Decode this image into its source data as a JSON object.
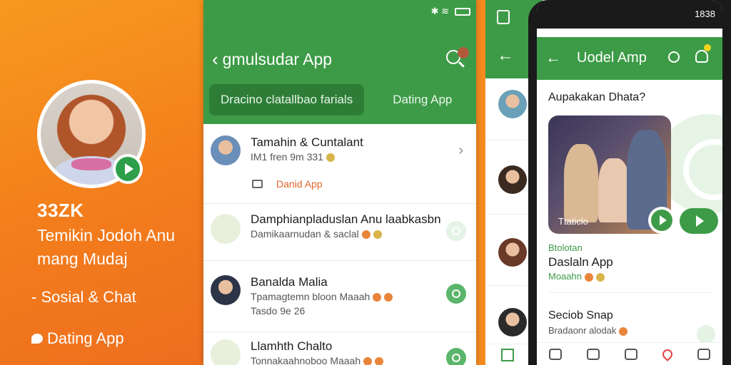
{
  "promo": {
    "brand": "33ZK",
    "tagline": "Temikin Jodoh Anu mang Mudaj",
    "feature_1": "- Sosial & Chat",
    "feature_2": "Dating App"
  },
  "middle_screen": {
    "title": "gmulsudar App",
    "tabs": [
      {
        "label": "Dracino clatallbao farials",
        "active": true
      },
      {
        "label": "Dating App",
        "active": false
      }
    ],
    "chats": [
      {
        "name": "Tamahin & Cuntalant",
        "message": "IM1 fren 9m 331",
        "folder_label": "Danid App"
      },
      {
        "name": "Damphianpladuslan Anu laabkasbn",
        "message": "Damikaarnudan & saclal"
      },
      {
        "name": "Banalda Malia",
        "message": "Tpamagtemn bloon Maaah",
        "message_2": "Tasdo 9e 26"
      },
      {
        "name": "Llamhth Chalto",
        "message": "Tonnakaahnoboo Maaah"
      }
    ]
  },
  "right_screen": {
    "status_time": "1838",
    "title": "Uodel Amp",
    "section_title": "Aupakakan Dhata?",
    "photo_caption": "Ttaticlo",
    "tag": "Btolotan",
    "card_title": "Daslaln App",
    "card_subtitle": "Moaahn",
    "section_2_title": "Seciob Snap",
    "section_2_subtitle": "Bradaonr alodak"
  },
  "colors": {
    "promo_orange": "#f37d1c",
    "brand_green": "#3d9b47",
    "accent_orange": "#e0662a"
  }
}
